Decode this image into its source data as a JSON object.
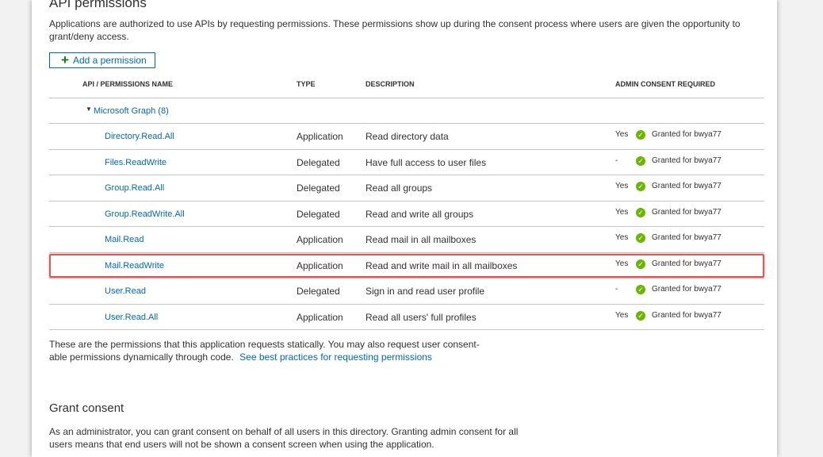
{
  "section": {
    "title": "API permissions",
    "description": "Applications are authorized to use APIs by requesting permissions. These permissions show up during the consent process where users are given the opportunity to grant/deny access."
  },
  "add_button": {
    "label": "Add a permission",
    "icon": "plus-icon"
  },
  "table": {
    "headers": {
      "name": "API / PERMISSIONS NAME",
      "type": "TYPE",
      "description": "DESCRIPTION",
      "admin": "ADMIN CONSENT REQUIRED"
    },
    "group": {
      "label": "Microsoft Graph (8)",
      "icon": "caret-down-icon"
    },
    "rows": [
      {
        "name": "Directory.Read.All",
        "type": "Application",
        "description": "Read directory data",
        "admin": "Yes",
        "status": "Granted for bwya77"
      },
      {
        "name": "Files.ReadWrite",
        "type": "Delegated",
        "description": "Have full access to user files",
        "admin": "-",
        "status": "Granted for bwya77"
      },
      {
        "name": "Group.Read.All",
        "type": "Delegated",
        "description": "Read all groups",
        "admin": "Yes",
        "status": "Granted for bwya77"
      },
      {
        "name": "Group.ReadWrite.All",
        "type": "Delegated",
        "description": "Read and write all groups",
        "admin": "Yes",
        "status": "Granted for bwya77"
      },
      {
        "name": "Mail.Read",
        "type": "Application",
        "description": "Read mail in all mailboxes",
        "admin": "Yes",
        "status": "Granted for bwya77"
      },
      {
        "name": "Mail.ReadWrite",
        "type": "Application",
        "description": "Read and write mail in all mailboxes",
        "admin": "Yes",
        "status": "Granted for bwya77"
      },
      {
        "name": "User.Read",
        "type": "Delegated",
        "description": "Sign in and read user profile",
        "admin": "-",
        "status": "Granted for bwya77"
      },
      {
        "name": "User.Read.All",
        "type": "Application",
        "description": "Read all users' full profiles",
        "admin": "Yes",
        "status": "Granted for bwya77"
      }
    ],
    "status_icon": "check-circle-icon",
    "status_color": "#6bb700"
  },
  "footer_note": {
    "line1": "These are the permissions that this application requests statically. You may also request user consent-",
    "line2": "able permissions dynamically through code.",
    "link": "See best practices for requesting permissions"
  },
  "grant": {
    "title": "Grant consent",
    "line1": "As an administrator, you can grant consent on behalf of all users in this directory. Granting admin consent for all",
    "line2": "users means that end users will not be shown a consent screen when using the application."
  }
}
